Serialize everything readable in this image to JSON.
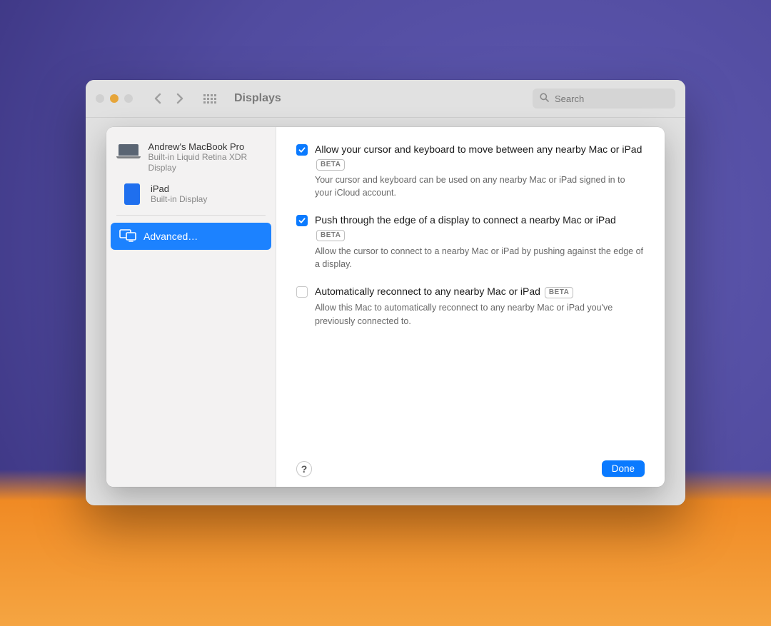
{
  "toolbar": {
    "title": "Displays",
    "search_placeholder": "Search"
  },
  "sidebar": {
    "devices": [
      {
        "name": "Andrew's MacBook Pro",
        "subtitle": "Built-in Liquid Retina XDR Display"
      },
      {
        "name": "iPad",
        "subtitle": "Built-in Display"
      }
    ],
    "advanced_label": "Advanced…"
  },
  "options": [
    {
      "checked": true,
      "title": "Allow your cursor and keyboard to move between any nearby Mac or iPad",
      "badge": "BETA",
      "desc": "Your cursor and keyboard can be used on any nearby Mac or iPad signed in to your iCloud account."
    },
    {
      "checked": true,
      "title": "Push through the edge of a display to connect a nearby Mac or iPad",
      "badge": "BETA",
      "desc": "Allow the cursor to connect to a nearby Mac or iPad by pushing against the edge of a display."
    },
    {
      "checked": false,
      "title": "Automatically reconnect to any nearby Mac or iPad",
      "badge": "BETA",
      "desc": "Allow this Mac to automatically reconnect to any nearby Mac or iPad you've previously connected to."
    }
  ],
  "footer": {
    "help": "?",
    "done": "Done"
  }
}
